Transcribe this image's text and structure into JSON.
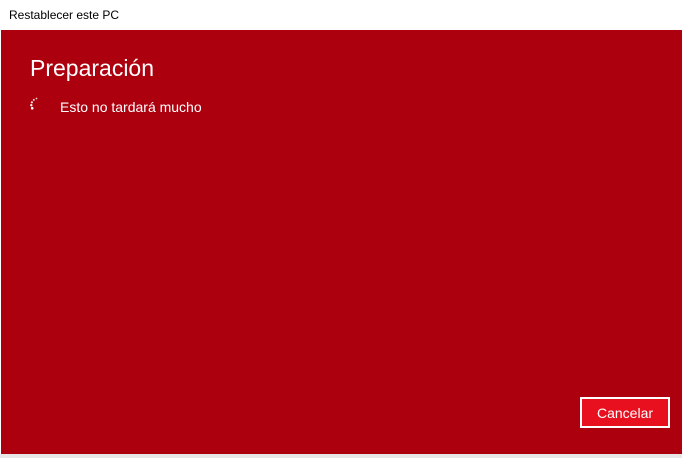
{
  "window": {
    "title": "Restablecer este PC"
  },
  "main": {
    "heading": "Preparación",
    "status": "Esto no tardará mucho",
    "spinner_icon": "loading-spinner-icon"
  },
  "footer": {
    "cancel_label": "Cancelar"
  },
  "colors": {
    "background": "#ad000e",
    "button": "#e8101f",
    "text": "#ffffff"
  }
}
